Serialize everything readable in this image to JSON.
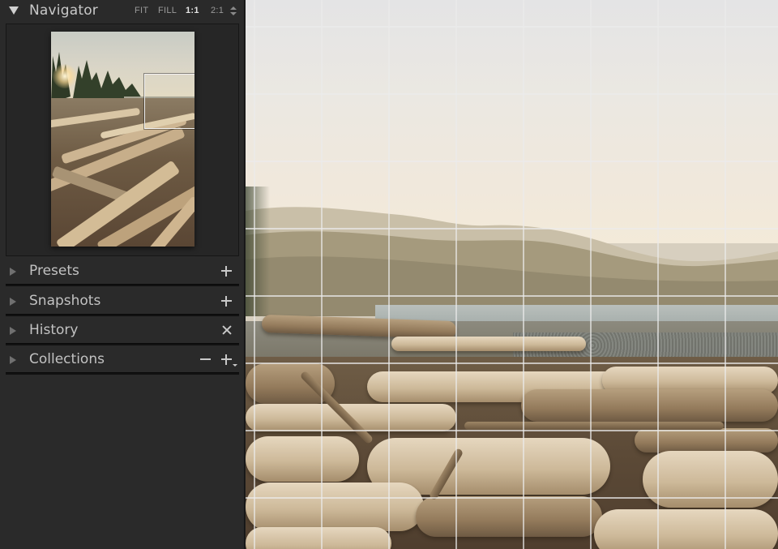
{
  "navigator": {
    "title": "Navigator",
    "zoom_options": [
      "FIT",
      "FILL",
      "1:1",
      "2:1"
    ],
    "active_zoom": "1:1"
  },
  "panels": [
    {
      "label": "Presets",
      "actions": [
        "plus-icon"
      ]
    },
    {
      "label": "Snapshots",
      "actions": [
        "plus-icon"
      ]
    },
    {
      "label": "History",
      "actions": [
        "close-icon"
      ]
    },
    {
      "label": "Collections",
      "actions": [
        "minus-icon",
        "plus-icon"
      ]
    }
  ],
  "colors": {
    "panel_bg": "#2a2a2a",
    "panel_text": "#c2c2c2",
    "grid_line": "#ebebeb"
  },
  "main_view": {
    "overlay": "grid"
  }
}
